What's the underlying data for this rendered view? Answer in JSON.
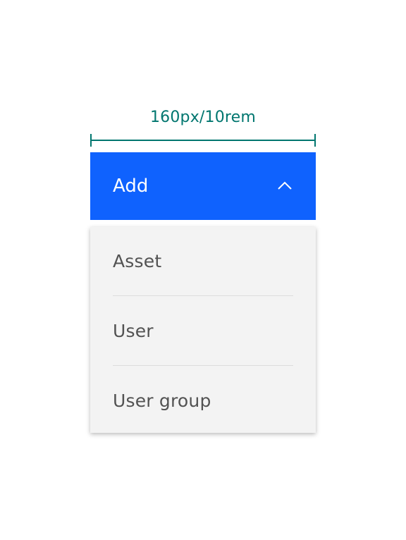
{
  "measurement": {
    "label": "160px/10rem",
    "color": "#00766f"
  },
  "dropdown": {
    "trigger_label": "Add",
    "trigger_icon": "chevron-up-icon",
    "background_color": "#0f62fe",
    "expanded": true,
    "items": [
      {
        "label": "Asset"
      },
      {
        "label": "User"
      },
      {
        "label": "User group"
      }
    ]
  }
}
